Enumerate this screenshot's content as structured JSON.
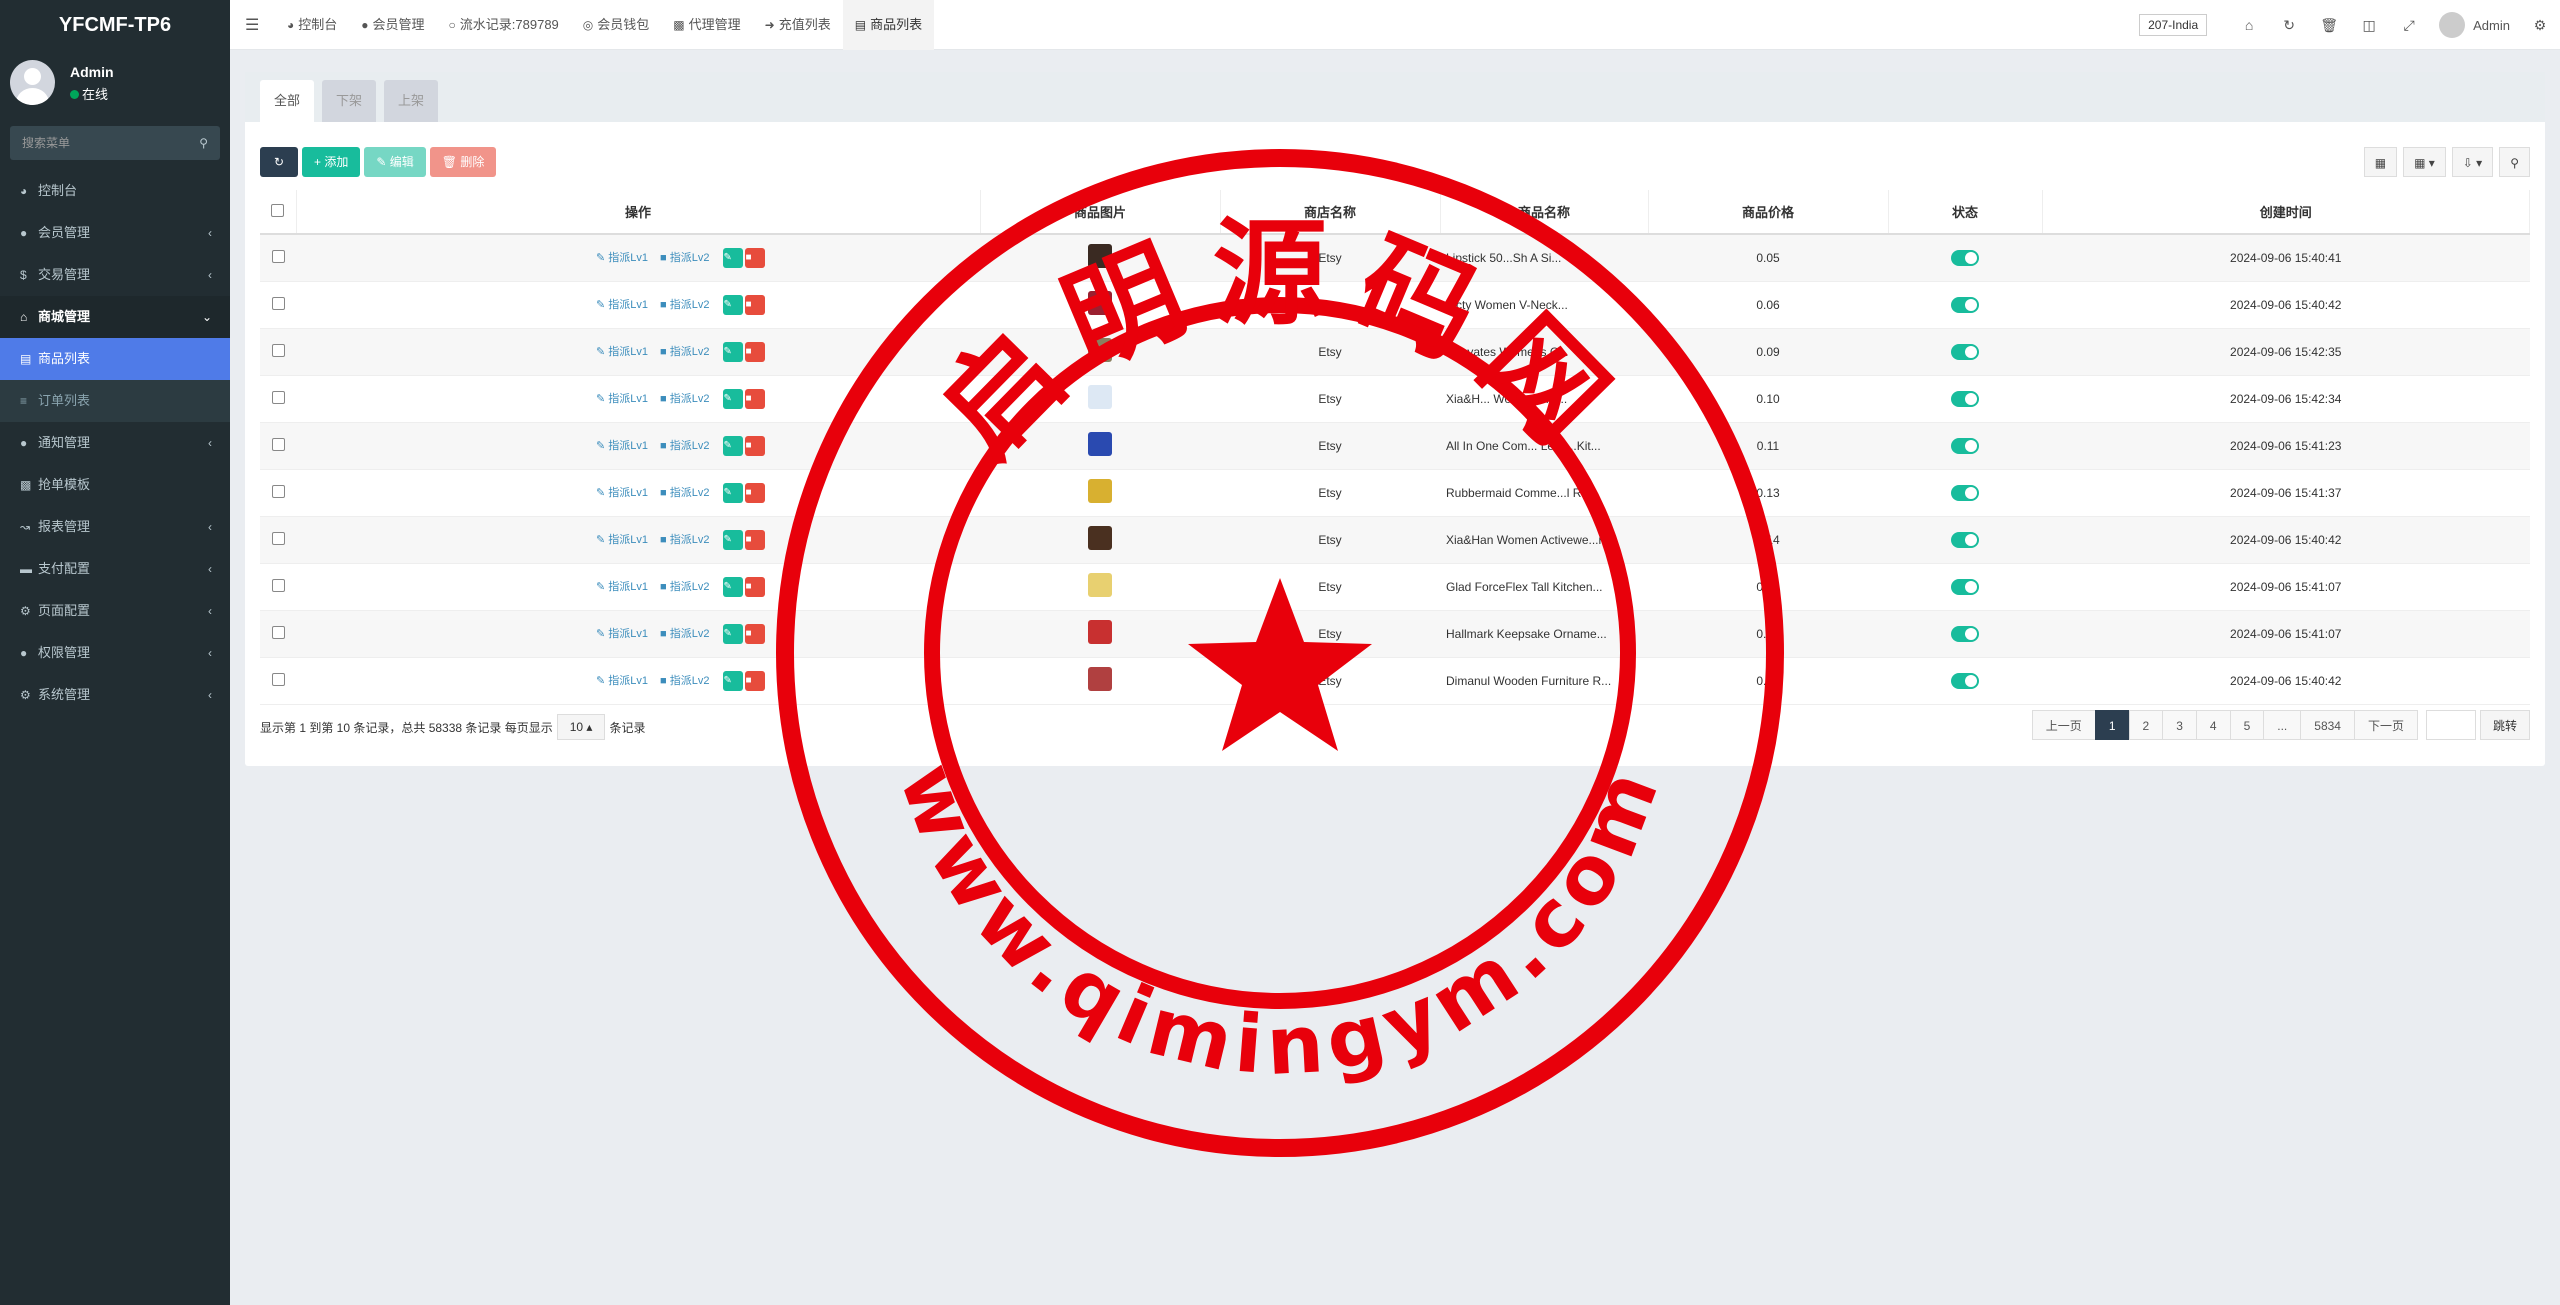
{
  "sidebar": {
    "logo": "YFCMF-TP6",
    "user_name": "Admin",
    "user_status": "在线",
    "search_placeholder": "搜索菜单",
    "items": [
      {
        "label": "控制台",
        "icon": "dashboard-icon"
      },
      {
        "label": "会员管理",
        "icon": "user-icon"
      },
      {
        "label": "交易管理",
        "icon": "dollar-icon"
      },
      {
        "label": "商城管理",
        "icon": "home-icon"
      },
      {
        "label": "商品列表",
        "icon": "desktop-icon"
      },
      {
        "label": "订单列表",
        "icon": "list-icon"
      },
      {
        "label": "通知管理",
        "icon": "bell-icon"
      },
      {
        "label": "抢单模板",
        "icon": "sitemap-icon"
      },
      {
        "label": "报表管理",
        "icon": "line-chart-icon"
      },
      {
        "label": "支付配置",
        "icon": "credit-card-icon"
      },
      {
        "label": "页面配置",
        "icon": "cog-icon"
      },
      {
        "label": "权限管理",
        "icon": "users-icon"
      },
      {
        "label": "系统管理",
        "icon": "cogs-icon"
      }
    ]
  },
  "topbar": {
    "tabs": [
      {
        "label": "控制台",
        "icon": "dashboard-icon"
      },
      {
        "label": "会员管理",
        "icon": "user-icon"
      },
      {
        "label": "流水记录:789789",
        "icon": "circle-icon"
      },
      {
        "label": "会员钱包",
        "icon": "wallet-icon"
      },
      {
        "label": "代理管理",
        "icon": "sitemap-icon"
      },
      {
        "label": "充值列表",
        "icon": "sign-in-icon"
      },
      {
        "label": "商品列表",
        "icon": "desktop-icon"
      }
    ],
    "country": "207-India",
    "admin_name": "Admin"
  },
  "content": {
    "subtabs": [
      "全部",
      "下架",
      "上架"
    ],
    "buttons": {
      "add": "添加",
      "edit": "编辑",
      "delete": "删除"
    },
    "columns": [
      "操作",
      "商品图片",
      "商店名称",
      "商品名称",
      "商品价格",
      "状态",
      "创建时间"
    ],
    "op_labels": {
      "lv1": "指派Lv1",
      "lv2": "指派Lv2"
    },
    "rows": [
      {
        "store": "Etsy",
        "name": "Lipstick 50...Sh A Si...",
        "price": "0.05",
        "time": "2024-09-06 15:40:41",
        "thumb_color": "#3a2a22"
      },
      {
        "store": "Etsy",
        "name": "...cty Women V-Neck...",
        "price": "0.06",
        "time": "2024-09-06 15:40:42",
        "thumb_color": "#9a2030"
      },
      {
        "store": "Etsy",
        "name": "Kirbyates Womens C...",
        "price": "0.09",
        "time": "2024-09-06 15:42:35",
        "thumb_color": "#8a8060"
      },
      {
        "store": "Etsy",
        "name": "Xia&H... Womens Tu...",
        "price": "0.10",
        "time": "2024-09-06 15:42:34",
        "thumb_color": "#dde8f4"
      },
      {
        "store": "Etsy",
        "name": "All In One Com... Lens...Kit...",
        "price": "0.11",
        "time": "2024-09-06 15:41:23",
        "thumb_color": "#2a4ab0"
      },
      {
        "store": "Etsy",
        "name": "Rubbermaid Comme...l RC...",
        "price": "0.13",
        "time": "2024-09-06 15:41:37",
        "thumb_color": "#d8b030"
      },
      {
        "store": "Etsy",
        "name": "Xia&Han Women Activewe...r ...",
        "price": "0.14",
        "time": "2024-09-06 15:40:42",
        "thumb_color": "#4a3020"
      },
      {
        "store": "Etsy",
        "name": "Glad ForceFlex Tall Kitchen...",
        "price": "0.15",
        "time": "2024-09-06 15:41:07",
        "thumb_color": "#e8d070"
      },
      {
        "store": "Etsy",
        "name": "Hallmark Keepsake Orname...",
        "price": "0.16",
        "time": "2024-09-06 15:41:07",
        "thumb_color": "#c83030"
      },
      {
        "store": "Etsy",
        "name": "Dimanul Wooden Furniture R...",
        "price": "0.17",
        "time": "2024-09-06 15:40:42",
        "thumb_color": "#b04040"
      }
    ],
    "pagination": {
      "info_prefix": "显示第 1 到第 10 条记录，总共 58338 条记录 每页显示",
      "page_size": "10",
      "info_suffix": "条记录",
      "prev": "上一页",
      "pages": [
        "1",
        "2",
        "3",
        "4",
        "5",
        "...",
        "5834"
      ],
      "next": "下一页",
      "jump": "跳转"
    }
  },
  "watermark": {
    "top_text": "启明源码网",
    "bottom_text": "www.qimingym.com",
    "color": "#e8000b"
  }
}
